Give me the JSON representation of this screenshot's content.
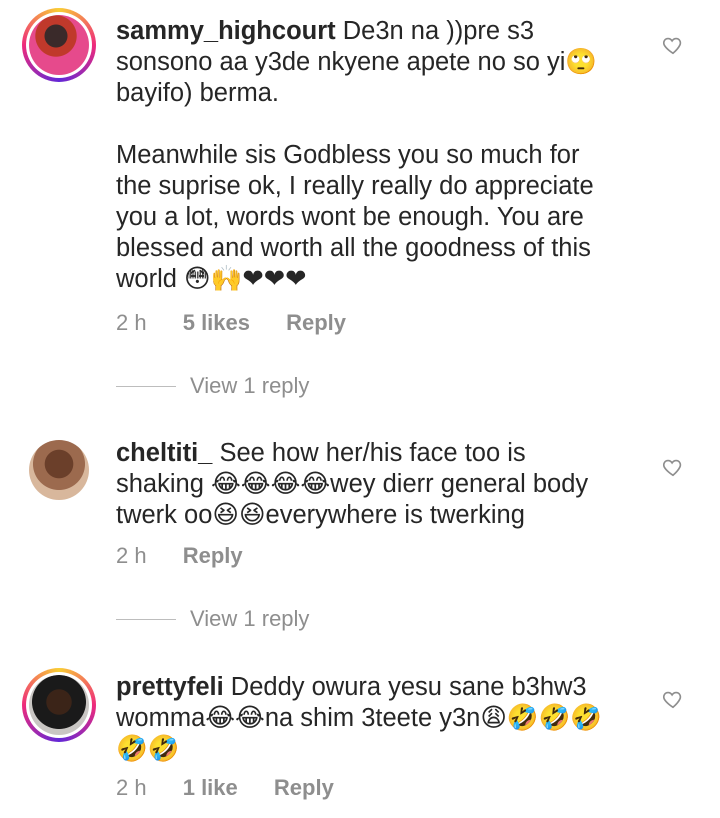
{
  "comments": [
    {
      "username": "sammy_highcourt",
      "text_lines": [
        "De3n na ))pre s3",
        "sonsono aa y3de nkyene apete no so yi🙄",
        "bayifo) berma.",
        "",
        "Meanwhile sis Godbless you so much for",
        "the suprise ok, I really really do appreciate",
        "you a lot, words wont be enough. You are",
        "blessed and worth all the goodness of this",
        "world 😳🙌❤❤❤"
      ],
      "time": "2 h",
      "likes": "5 likes",
      "reply_label": "Reply",
      "view_replies": "View 1 reply"
    },
    {
      "username": "cheltiti_",
      "text_lines": [
        "See how her/his face too is",
        "shaking 😂😂😂😂wey dierr general body",
        "twerk oo😆😆everywhere is twerking"
      ],
      "time": "2 h",
      "likes": "",
      "reply_label": "Reply",
      "view_replies": "View 1 reply"
    },
    {
      "username": "prettyfeli",
      "text_lines": [
        "Deddy owura yesu sane b3hw3",
        "womma😂😂na shim 3teete y3n😩🤣🤣🤣",
        "🤣🤣"
      ],
      "time": "2 h",
      "likes": "1 like",
      "reply_label": "Reply",
      "view_replies": ""
    }
  ],
  "icons": {
    "like": "heart-outline-icon"
  },
  "colors": {
    "text": "#262626",
    "muted": "#8e8e8e"
  }
}
